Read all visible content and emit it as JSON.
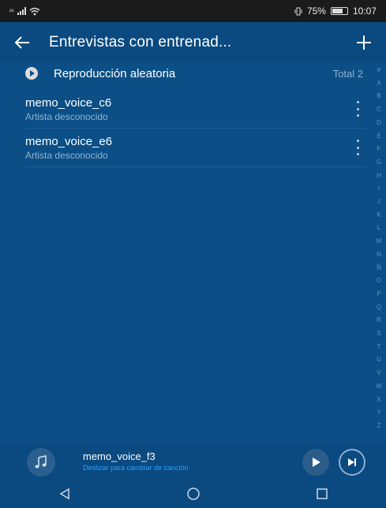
{
  "status": {
    "left_indicator": "²⁶",
    "battery_percent": "75%",
    "battery_level": 0.75,
    "time": "10:07"
  },
  "appbar": {
    "title": "Entrevistas con entrenad...",
    "back_icon": "arrow-left-icon",
    "add_icon": "plus-icon"
  },
  "shuffle": {
    "label": "Reproducción aleatoria",
    "total": "Total 2"
  },
  "songs": [
    {
      "title": "memo_voice_c6",
      "artist": "Artista desconocido"
    },
    {
      "title": "memo_voice_e6",
      "artist": "Artista desconocido"
    }
  ],
  "index_letters": [
    "#",
    "A",
    "B",
    "C",
    "D",
    "E",
    "F",
    "G",
    "H",
    "I",
    "J",
    "K",
    "L",
    "M",
    "N",
    "Ñ",
    "O",
    "P",
    "Q",
    "R",
    "S",
    "T",
    "U",
    "V",
    "W",
    "X",
    "Y",
    "Z"
  ],
  "player": {
    "title": "memo_voice_f3",
    "subtitle": "Deslizar para cambiar de canción"
  },
  "colors": {
    "background": "#0b4f86",
    "accent": "#2ea2ff"
  }
}
